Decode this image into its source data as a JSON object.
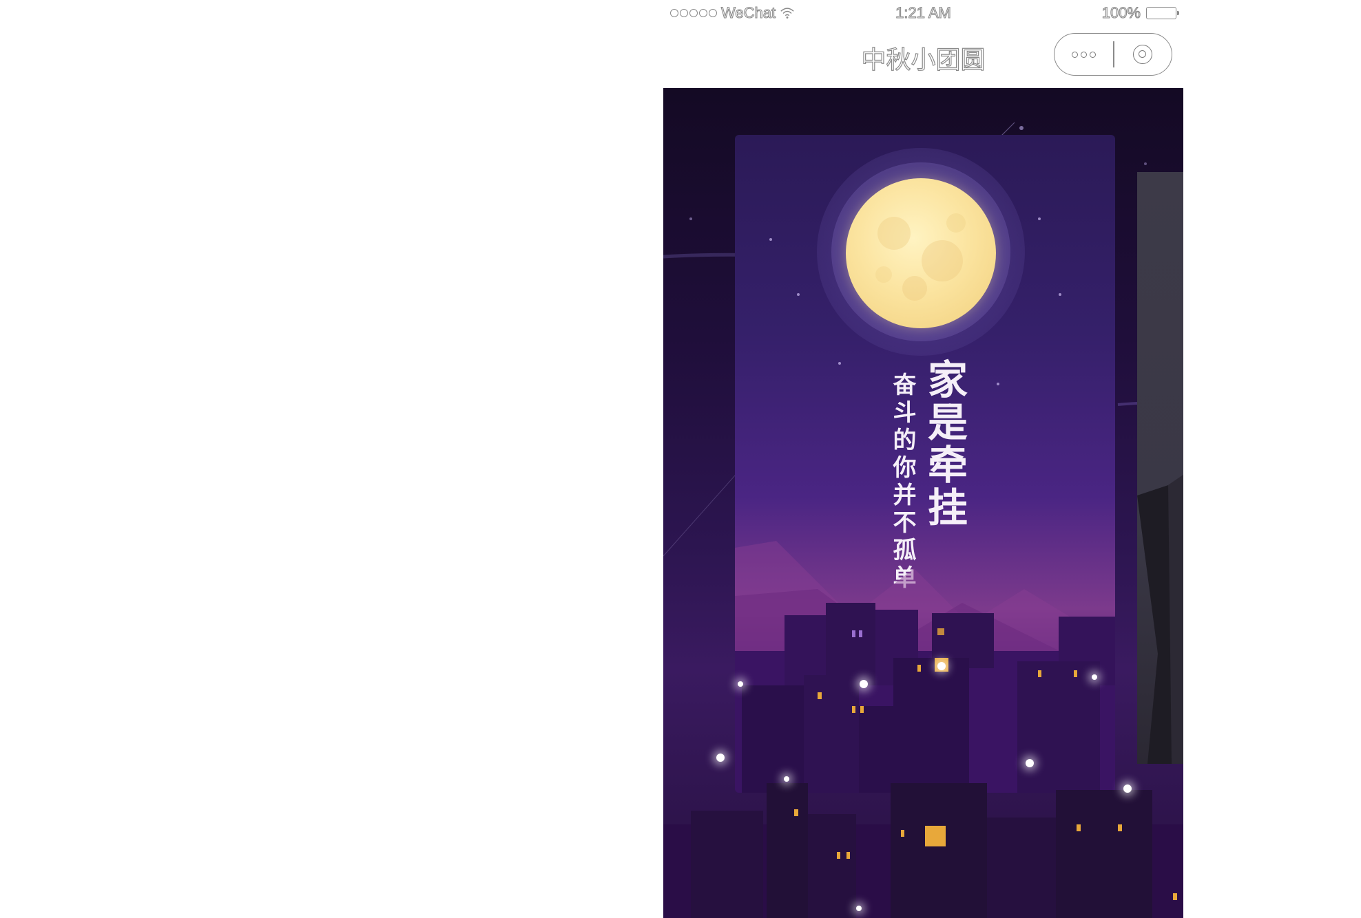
{
  "status_bar": {
    "carrier": "WeChat",
    "time": "1:21 AM",
    "battery": "100%",
    "icons": [
      "signal-icon",
      "wifi-icon",
      "battery-icon"
    ]
  },
  "nav": {
    "title": "中秋小团圆",
    "more_icon": "more-dots-icon",
    "close_icon": "mini-program-close-icon"
  },
  "poster": {
    "headline": "家是牵挂",
    "subline": "奋斗的你并不孤单"
  },
  "colors": {
    "sky_dark": "#140a24",
    "card_purple": "#35206a",
    "horizon_magenta": "#7c3a8c",
    "moon": "#fbe4a0",
    "window_light": "#e8a83a",
    "nav_outline": "#8a8a8a"
  }
}
